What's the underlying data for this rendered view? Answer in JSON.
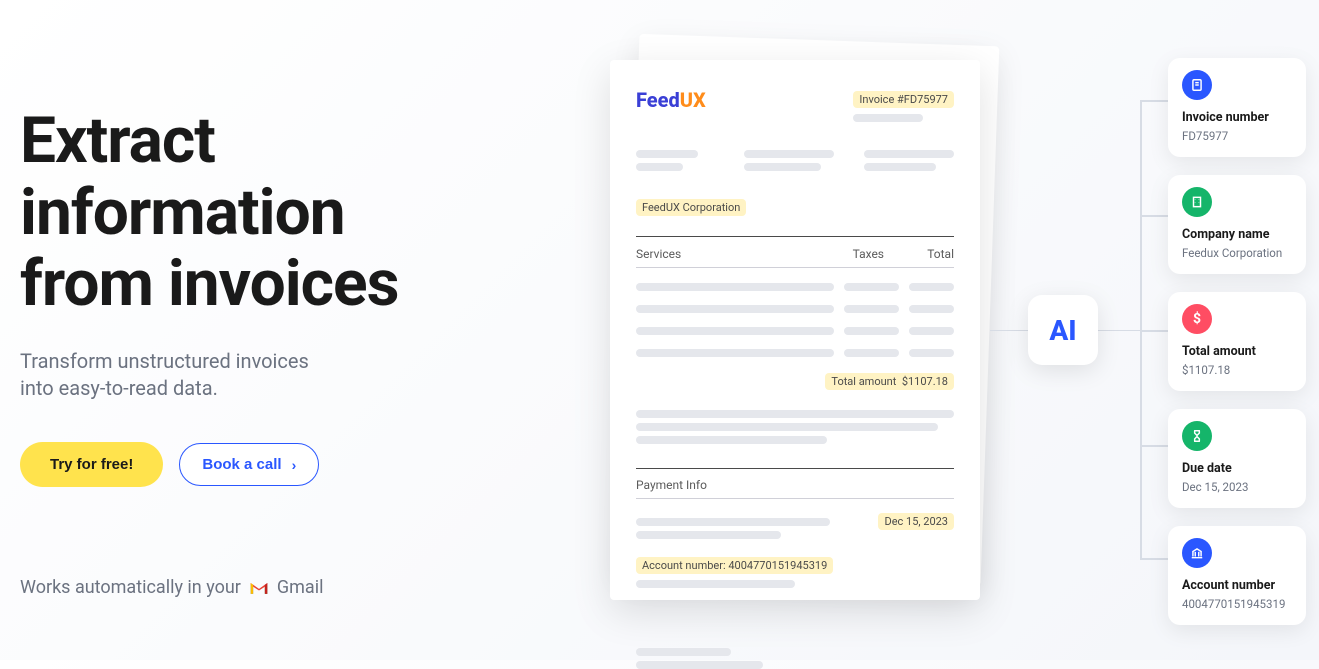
{
  "hero": {
    "headline_l1": "Extract",
    "headline_l2": "information",
    "headline_l3": "from invoices",
    "sub_l1": "Transform unstructured invoices",
    "sub_l2": "into easy-to-read data.",
    "cta_primary": "Try for free!",
    "cta_secondary": "Book a call",
    "works_prefix": "Works automatically in your",
    "works_suffix": "Gmail"
  },
  "invoice": {
    "logo_part1": "Feed",
    "logo_part2": "UX",
    "invoice_number_label": "Invoice #FD75977",
    "company_name": "FeedUX Corporation",
    "th_services": "Services",
    "th_taxes": "Taxes",
    "th_total": "Total",
    "total_amount_label": "Total amount",
    "total_amount_value": "$1107.18",
    "payment_info_header": "Payment Info",
    "account_number_label": "Account number:",
    "account_number_value": "4004770151945319",
    "due_date": "Dec 15, 2023"
  },
  "ai": {
    "label": "AI"
  },
  "cards": {
    "invoice_number": {
      "title": "Invoice number",
      "value": "FD75977"
    },
    "company_name": {
      "title": "Company name",
      "value": "Feedux Corporation"
    },
    "total_amount": {
      "title": "Total amount",
      "value": "$1107.18"
    },
    "due_date": {
      "title": "Due date",
      "value": "Dec 15, 2023"
    },
    "account_number": {
      "title": "Account number",
      "value": "4004770151945319"
    }
  }
}
